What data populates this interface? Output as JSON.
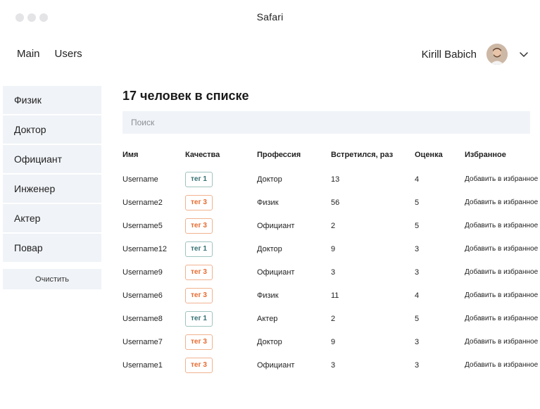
{
  "window": {
    "title": "Safari"
  },
  "nav": {
    "items": [
      "Main",
      "Users"
    ]
  },
  "user": {
    "name": "Kirill Babich"
  },
  "sidebar": {
    "items": [
      "Физик",
      "Доктор",
      "Официант",
      "Инженер",
      "Актер",
      "Повар"
    ],
    "clear_label": "Очистить"
  },
  "main": {
    "heading": "17 человек в списке",
    "search_placeholder": "Поиск"
  },
  "table": {
    "columns": [
      "Имя",
      "Качества",
      "Профессия",
      "Встретился, раз",
      "Оценка",
      "Избранное"
    ],
    "rows": [
      {
        "name": "Username",
        "tag": "тег 1",
        "tag_type": "t1",
        "profession": "Доктор",
        "met": "13",
        "rating": "4",
        "fav": "Добавить в избранное"
      },
      {
        "name": "Username2",
        "tag": "тег 3",
        "tag_type": "t3",
        "profession": "Физик",
        "met": "56",
        "rating": "5",
        "fav": "Добавить в избранное"
      },
      {
        "name": "Username5",
        "tag": "тег 3",
        "tag_type": "t3",
        "profession": "Официант",
        "met": "2",
        "rating": "5",
        "fav": "Добавить в избранное"
      },
      {
        "name": "Username12",
        "tag": "тег 1",
        "tag_type": "t1",
        "profession": "Доктор",
        "met": "9",
        "rating": "3",
        "fav": "Добавить в избранное"
      },
      {
        "name": "Username9",
        "tag": "тег 3",
        "tag_type": "t3",
        "profession": "Официант",
        "met": "3",
        "rating": "3",
        "fav": "Добавить в избранное"
      },
      {
        "name": "Username6",
        "tag": "тег 3",
        "tag_type": "t3",
        "profession": "Физик",
        "met": "11",
        "rating": "4",
        "fav": "Добавить в избранное"
      },
      {
        "name": "Username8",
        "tag": "тег 1",
        "tag_type": "t1",
        "profession": "Актер",
        "met": "2",
        "rating": "5",
        "fav": "Добавить в избранное"
      },
      {
        "name": "Username7",
        "tag": "тег 3",
        "tag_type": "t3",
        "profession": "Доктор",
        "met": "9",
        "rating": "3",
        "fav": "Добавить в избранное"
      },
      {
        "name": "Username1",
        "tag": "тег 3",
        "tag_type": "t3",
        "profession": "Официант",
        "met": "3",
        "rating": "3",
        "fav": "Добавить в избранное"
      }
    ]
  },
  "colors": {
    "panel": "#f0f3f7",
    "tag1": "#356f70",
    "tag3": "#e76a2e"
  },
  "icons": {
    "avatar": "avatar",
    "chevron": "chevron-down-icon"
  }
}
